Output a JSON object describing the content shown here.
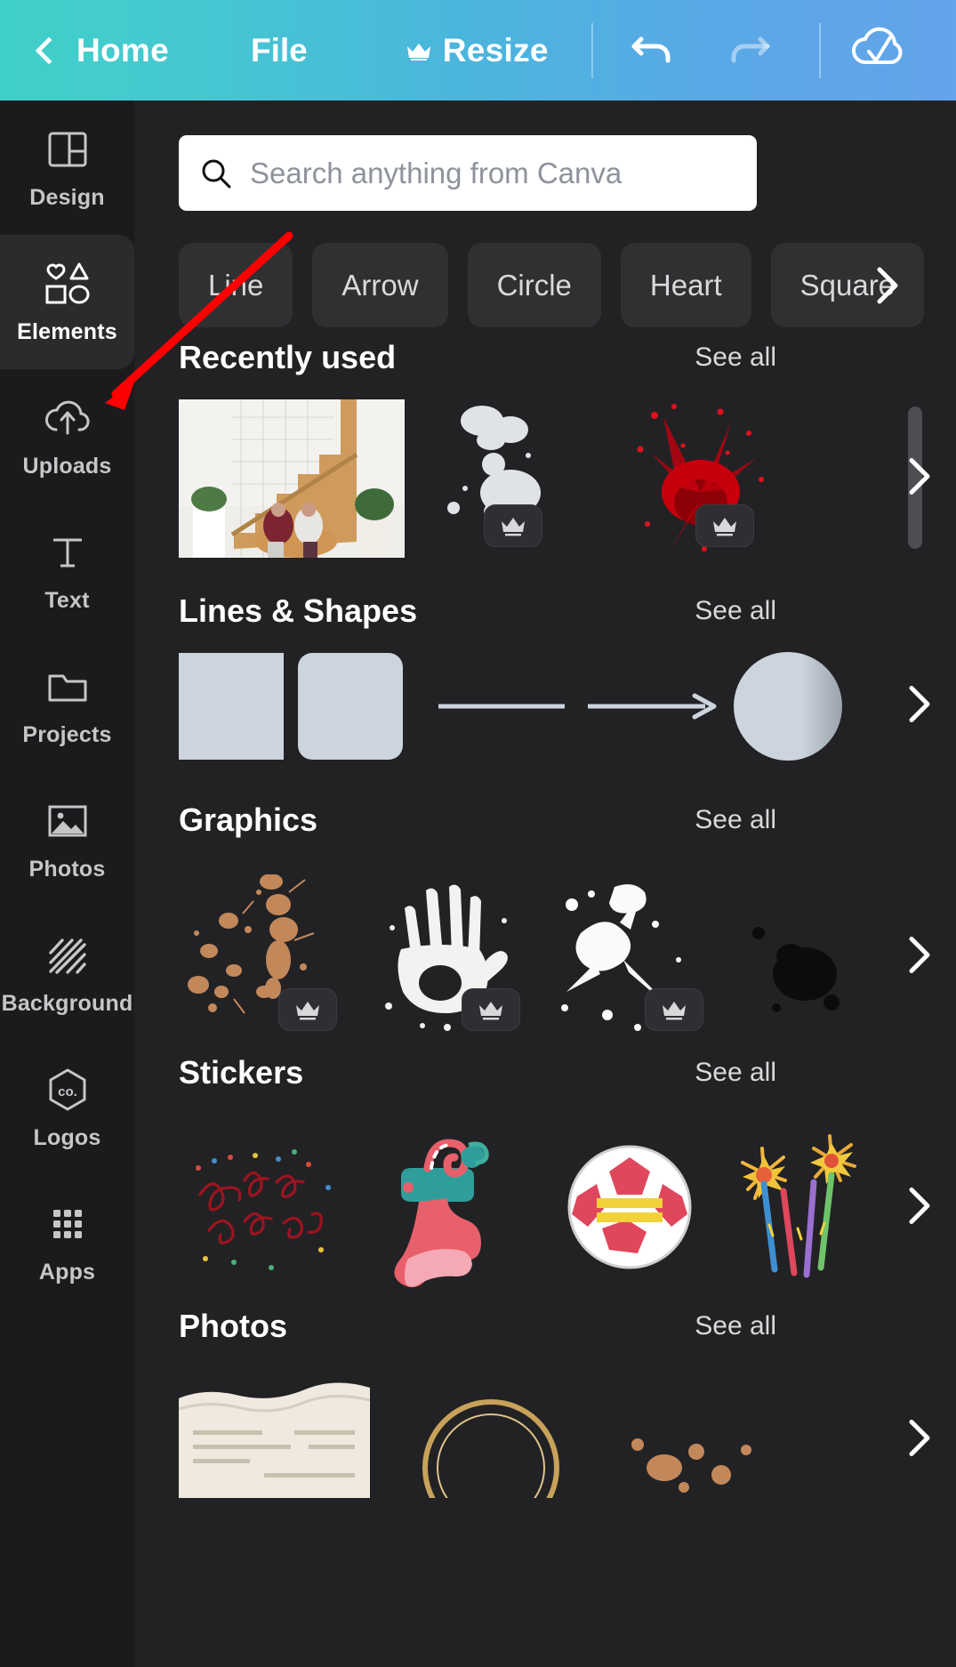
{
  "topbar": {
    "back_label": "Home",
    "file_label": "File",
    "resize_label": "Resize",
    "icons": [
      "chevron-left-icon",
      "crown-icon",
      "undo-icon",
      "redo-icon",
      "cloud-check-icon"
    ],
    "gradient_from": "#3fd0c9",
    "gradient_to": "#63a4ea"
  },
  "sidebar": {
    "items": [
      {
        "label": "Design",
        "icon": "layout-grid-icon",
        "active": false
      },
      {
        "label": "Elements",
        "icon": "shapes-icon",
        "active": true
      },
      {
        "label": "Uploads",
        "icon": "cloud-upload-icon",
        "active": false
      },
      {
        "label": "Text",
        "icon": "text-t-icon",
        "active": false
      },
      {
        "label": "Projects",
        "icon": "folder-icon",
        "active": false
      },
      {
        "label": "Photos",
        "icon": "image-icon",
        "active": false
      },
      {
        "label": "Background",
        "icon": "diagonal-stripes-icon",
        "active": false
      },
      {
        "label": "Logos",
        "icon": "hexagon-co-icon",
        "active": false
      },
      {
        "label": "Apps",
        "icon": "grid-dots-icon",
        "active": false
      }
    ]
  },
  "search": {
    "placeholder": "Search anything from Canva",
    "icon": "search-icon"
  },
  "chips": [
    {
      "label": "Line"
    },
    {
      "label": "Arrow"
    },
    {
      "label": "Circle"
    },
    {
      "label": "Heart"
    },
    {
      "label": "Square"
    }
  ],
  "chips_next_icon": "chevron-right-icon",
  "sections": [
    {
      "title": "Recently used",
      "see_all": "See all",
      "items": [
        {
          "name": "photo-staircase-interior",
          "premium": false
        },
        {
          "name": "white-paint-splatter",
          "premium": true
        },
        {
          "name": "red-blood-splatter",
          "premium": true
        }
      ]
    },
    {
      "title": "Lines & Shapes",
      "see_all": "See all",
      "items": [
        {
          "name": "square-shape",
          "premium": false
        },
        {
          "name": "rounded-square-shape",
          "premium": false
        },
        {
          "name": "line-shape",
          "premium": false
        },
        {
          "name": "arrow-shape",
          "premium": false
        },
        {
          "name": "circle-shape",
          "premium": false
        }
      ]
    },
    {
      "title": "Graphics",
      "see_all": "See all",
      "items": [
        {
          "name": "tan-paint-splatter",
          "premium": true
        },
        {
          "name": "white-handprint",
          "premium": true
        },
        {
          "name": "white-paint-splash",
          "premium": true
        },
        {
          "name": "black-ink-blot",
          "premium": false
        }
      ]
    },
    {
      "title": "Stickers",
      "see_all": "See all",
      "items": [
        {
          "name": "happy-new-year-script",
          "premium": false
        },
        {
          "name": "christmas-stocking",
          "premium": false
        },
        {
          "name": "soccer-ball",
          "premium": false
        },
        {
          "name": "fireworks",
          "premium": false
        }
      ]
    },
    {
      "title": "Photos",
      "see_all": "See all",
      "items": [
        {
          "name": "torn-paper-photo",
          "premium": false
        },
        {
          "name": "gold-circle-photo",
          "premium": false
        },
        {
          "name": "splatter-photo",
          "premium": false
        }
      ]
    }
  ],
  "annotation": {
    "type": "red-arrow",
    "color": "#ff0000",
    "points_to": "Elements"
  },
  "colors": {
    "panel_bg": "#222225",
    "sidebar_bg": "#1b1b1e",
    "chip_bg": "#303033",
    "shape_fill": "#ccd4dd"
  }
}
